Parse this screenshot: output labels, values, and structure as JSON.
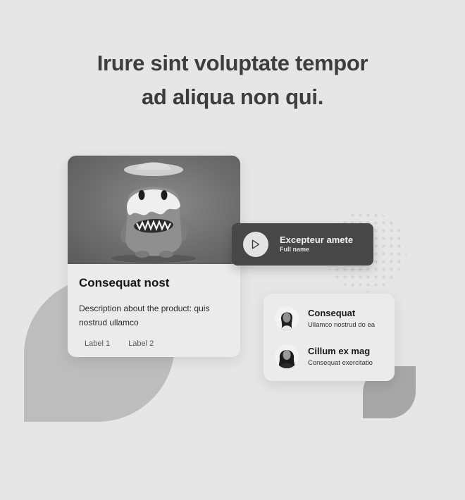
{
  "headline": {
    "line1": "Irure sint voluptate tempor",
    "line2": "ad aliqua non qui."
  },
  "product_card": {
    "image": "monster-toy-illustration",
    "title": "Consequat nost",
    "description": "Description about the product: quis nostrud ullamco",
    "labels": [
      "Label 1",
      "Label 2"
    ]
  },
  "player": {
    "icon": "play-icon",
    "title": "Excepteur amete",
    "subtitle": "Full name"
  },
  "people": [
    {
      "name": "Consequat",
      "subtitle": "Ullamco nostrud do ea"
    },
    {
      "name": "Cillum ex mag",
      "subtitle": "Consequat exercitatio"
    }
  ],
  "colors": {
    "background": "#e6e6e6",
    "heading": "#3d3d3d",
    "player_bg": "#474747",
    "blob_large": "#bdbdbd",
    "blob_small": "#a7a7a7"
  }
}
